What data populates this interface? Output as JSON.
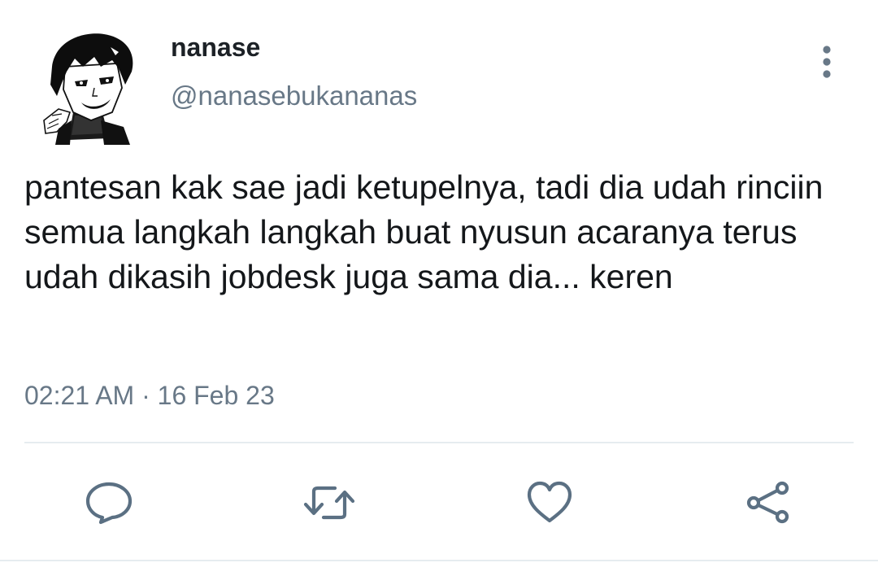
{
  "tweet": {
    "display_name": "nanase",
    "handle": "@nanasebukananas",
    "text": "pantesan kak sae jadi ketupelnya, tadi dia udah rinciin semua langkah langkah buat nyusun acaranya terus udah dikasih jobdesk juga sama dia... keren",
    "time": "02:21 AM",
    "separator": "·",
    "date": "16 Feb 23"
  },
  "actions": [
    {
      "name": "reply",
      "icon": "speech-bubble-icon"
    },
    {
      "name": "retweet",
      "icon": "retweet-icon"
    },
    {
      "name": "like",
      "icon": "heart-icon"
    },
    {
      "name": "share",
      "icon": "share-icon"
    }
  ],
  "colors": {
    "text": "#14171a",
    "secondary": "#687887",
    "icon": "#5b7083",
    "divider": "#e6ecf0",
    "background": "#ffffff"
  }
}
